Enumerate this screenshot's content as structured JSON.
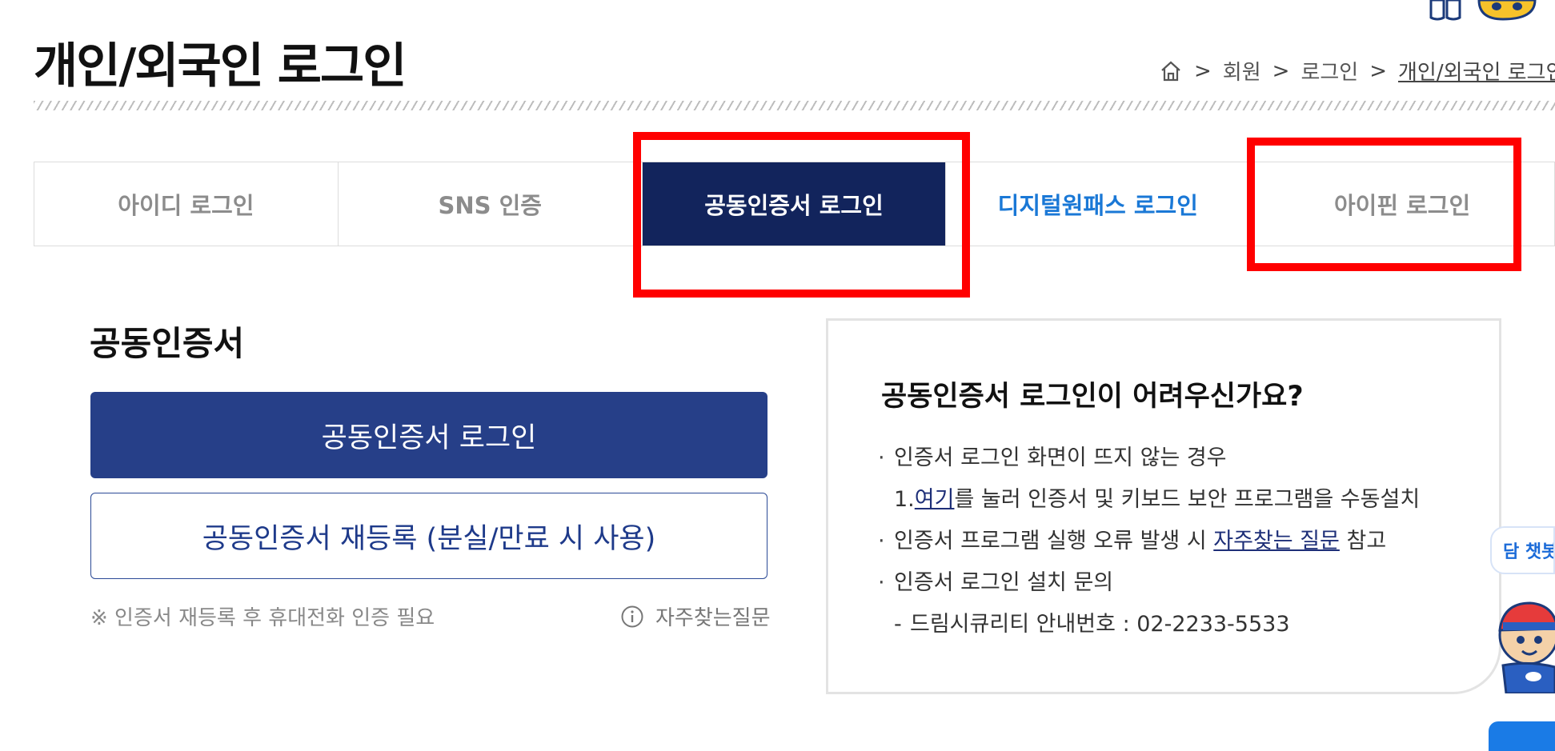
{
  "page": {
    "title": "개인/외국인 로그인"
  },
  "breadcrumb": {
    "home_icon": "home-icon",
    "separator": ">",
    "items": [
      "회원",
      "로그인",
      "개인/외국인 로그인"
    ]
  },
  "tabs": [
    {
      "label": "아이디 로그인",
      "state": "inactive"
    },
    {
      "label": "SNS 인증",
      "state": "inactive"
    },
    {
      "label": "공동인증서 로그인",
      "state": "active"
    },
    {
      "label": "디지털원패스 로그인",
      "state": "highlight"
    },
    {
      "label": "아이핀 로그인",
      "state": "inactive"
    }
  ],
  "certificate": {
    "section_title": "공동인증서",
    "login_button": "공동인증서 로그인",
    "reregister_button": "공동인증서 재등록 (분실/만료 시 사용)",
    "note": "※ 인증서 재등록 후 휴대전화 인증 필요",
    "faq_link": "자주찾는질문",
    "faq_icon": "info-icon"
  },
  "help": {
    "title": "공동인증서 로그인이 어려우신가요?",
    "bullet": "·",
    "line1": "인증서 로그인 화면이 뜨지 않는 경우",
    "line2_prefix": "1.",
    "line2_link": "여기",
    "line2_suffix": "를 눌러 인증서 및 키보드 보안 프로그램을 수동설치",
    "line3_prefix": "인증서 프로그램 실행 오류 발생 시 ",
    "line3_link": "자주찾는 질문",
    "line3_suffix": " 참고",
    "line4": "인증서 로그인 설치 문의",
    "line5_dash": "-",
    "line5": "드림시큐리티 안내번호 : 02-2233-5533"
  },
  "chatbot": {
    "label": "담 챗봇"
  },
  "colors": {
    "active_tab": "#12245c",
    "primary_button": "#263f88",
    "link_blue": "#1a78d6",
    "annotation_red": "#ff0000"
  }
}
